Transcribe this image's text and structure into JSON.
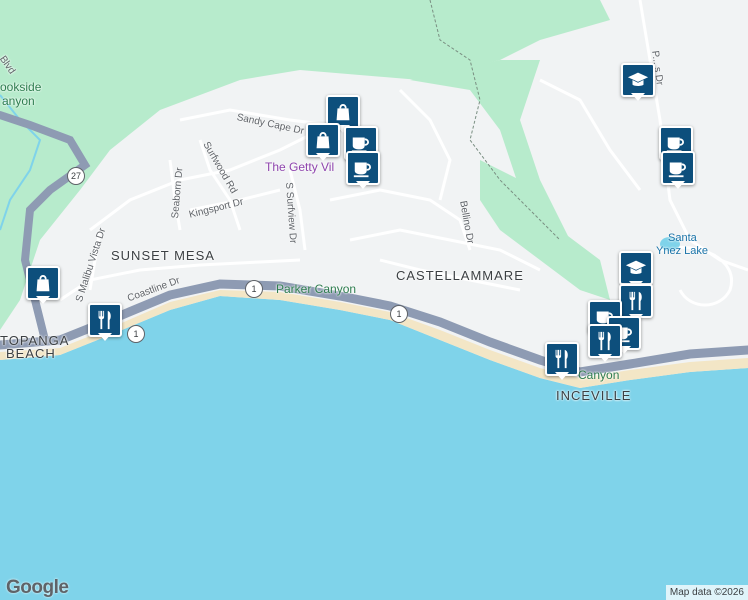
{
  "map": {
    "area_labels": [
      {
        "id": "sunset-mesa",
        "text": "SUNSET MESA"
      },
      {
        "id": "castellammare",
        "text": "CASTELLAMMARE"
      },
      {
        "id": "topanga-beach-1",
        "text": "TOPANGA"
      },
      {
        "id": "topanga-beach-2",
        "text": "BEACH"
      },
      {
        "id": "inceville",
        "text": "INCEVILLE"
      }
    ],
    "street_labels": [
      {
        "id": "sandy-cape-dr",
        "text": "Sandy Cape Dr"
      },
      {
        "id": "surfwood-rd",
        "text": "Surfwood Rd"
      },
      {
        "id": "seaborn-dr",
        "text": "Seaborn Dr"
      },
      {
        "id": "kingsport-dr",
        "text": "Kingsport Dr"
      },
      {
        "id": "s-surfview-dr",
        "text": "S Surfview Dr"
      },
      {
        "id": "s-malibu-vista-dr",
        "text": "S Malibu Vista Dr"
      },
      {
        "id": "coastline-dr",
        "text": "Coastline Dr"
      },
      {
        "id": "bellino-dr",
        "text": "Bellino Dr"
      },
      {
        "id": "blvd",
        "text": "Blvd"
      },
      {
        "id": "p-dr",
        "text": "P... s Dr"
      }
    ],
    "park_labels": [
      {
        "id": "parker-canyon",
        "text": "Parker Canyon"
      },
      {
        "id": "brookside-1",
        "text": "ookside"
      },
      {
        "id": "brookside-2",
        "text": "anyon"
      },
      {
        "id": "santa-ynez-canyon",
        "text": "Canyon"
      }
    ],
    "poi_labels": [
      {
        "id": "getty-villa",
        "text": "The Getty Vil"
      }
    ],
    "lake_labels": [
      {
        "id": "santa-ynez-lake",
        "lines": [
          "Santa",
          "Ynez Lake"
        ]
      }
    ],
    "route_shields": [
      {
        "id": "route-27",
        "text": "27"
      },
      {
        "id": "route-1-a",
        "text": "1"
      },
      {
        "id": "route-1-b",
        "text": "1"
      },
      {
        "id": "route-1-c",
        "text": "1"
      }
    ],
    "markers": [
      {
        "id": "shop-1",
        "icon": "shopping-bag"
      },
      {
        "id": "shop-2",
        "icon": "shopping-bag"
      },
      {
        "id": "shop-3",
        "icon": "shopping-bag"
      },
      {
        "id": "cafe-1",
        "icon": "coffee-cup"
      },
      {
        "id": "cafe-2",
        "icon": "coffee-cup"
      },
      {
        "id": "cafe-3",
        "icon": "coffee-cup"
      },
      {
        "id": "cafe-4",
        "icon": "coffee-cup"
      },
      {
        "id": "cafe-5",
        "icon": "coffee-cup"
      },
      {
        "id": "cafe-6",
        "icon": "coffee-cup"
      },
      {
        "id": "school-1",
        "icon": "graduation-cap"
      },
      {
        "id": "school-2",
        "icon": "graduation-cap"
      },
      {
        "id": "restaurant-1",
        "icon": "fork-knife"
      },
      {
        "id": "restaurant-2",
        "icon": "fork-knife"
      },
      {
        "id": "restaurant-3",
        "icon": "fork-knife"
      },
      {
        "id": "restaurant-4",
        "icon": "fork-knife"
      }
    ],
    "colors": {
      "water": "#7fd3ea",
      "land": "#f1f3f4",
      "park": "#b7ebcc",
      "beach": "#f3e6c6",
      "highway": "#8e9bb3",
      "marker": "#0d4f7c"
    }
  },
  "logo": "Google",
  "attribution": "Map data ©2026"
}
